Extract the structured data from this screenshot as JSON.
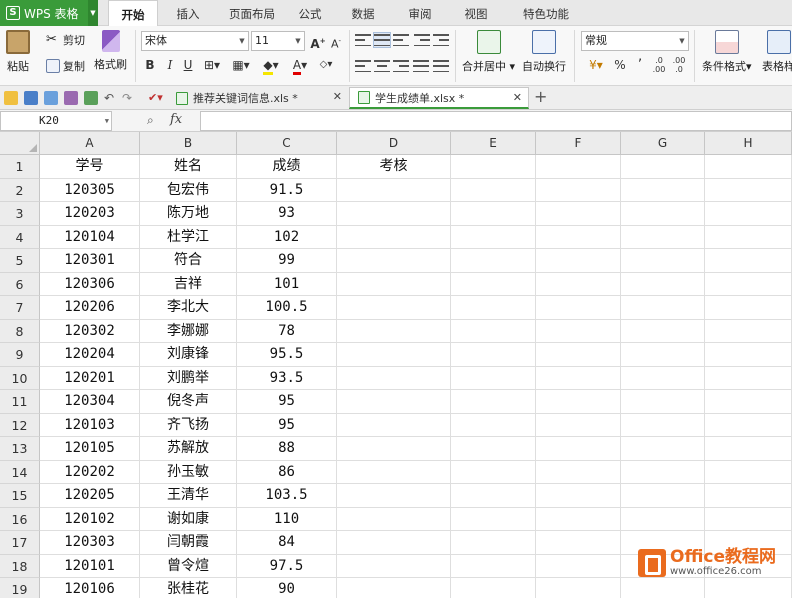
{
  "app": {
    "name": "WPS 表格",
    "accent": "#3a9b3a"
  },
  "menu_tabs": [
    "开始",
    "插入",
    "页面布局",
    "公式",
    "数据",
    "审阅",
    "视图",
    "特色功能"
  ],
  "ribbon": {
    "paste": "粘贴",
    "cut": "剪切",
    "copy": "复制",
    "format_painter": "格式刷",
    "font_name": "宋体",
    "font_size": "11",
    "bold": "B",
    "italic": "I",
    "underline": "U",
    "merge_center": "合并居中",
    "wrap_text": "自动换行",
    "number_format": "常规",
    "percent": "%",
    "cond_format": "条件格式",
    "table_style": "表格样"
  },
  "doc_tabs": [
    {
      "label": "推荐关键词信息.xls *"
    },
    {
      "label": "学生成绩单.xlsx *"
    }
  ],
  "formula_bar": {
    "cell_ref": "K20",
    "fx": "fx"
  },
  "columns": [
    "A",
    "B",
    "C",
    "D",
    "E",
    "F",
    "G",
    "H"
  ],
  "headers": [
    "学号",
    "姓名",
    "成绩",
    "考核"
  ],
  "rows": [
    {
      "id": "120305",
      "name": "包宏伟",
      "score": "91.5"
    },
    {
      "id": "120203",
      "name": "陈万地",
      "score": "93"
    },
    {
      "id": "120104",
      "name": "杜学江",
      "score": "102"
    },
    {
      "id": "120301",
      "name": "符合",
      "score": "99"
    },
    {
      "id": "120306",
      "name": "吉祥",
      "score": "101"
    },
    {
      "id": "120206",
      "name": "李北大",
      "score": "100.5"
    },
    {
      "id": "120302",
      "name": "李娜娜",
      "score": "78"
    },
    {
      "id": "120204",
      "name": "刘康锋",
      "score": "95.5"
    },
    {
      "id": "120201",
      "name": "刘鹏举",
      "score": "93.5"
    },
    {
      "id": "120304",
      "name": "倪冬声",
      "score": "95"
    },
    {
      "id": "120103",
      "name": "齐飞扬",
      "score": "95"
    },
    {
      "id": "120105",
      "name": "苏解放",
      "score": "88"
    },
    {
      "id": "120202",
      "name": "孙玉敏",
      "score": "86"
    },
    {
      "id": "120205",
      "name": "王清华",
      "score": "103.5"
    },
    {
      "id": "120102",
      "name": "谢如康",
      "score": "110"
    },
    {
      "id": "120303",
      "name": "闫朝霞",
      "score": "84"
    },
    {
      "id": "120101",
      "name": "曾令煊",
      "score": "97.5"
    },
    {
      "id": "120106",
      "name": "张桂花",
      "score": "90"
    }
  ],
  "watermark": {
    "title": "Office教程网",
    "url": "www.office26.com"
  }
}
